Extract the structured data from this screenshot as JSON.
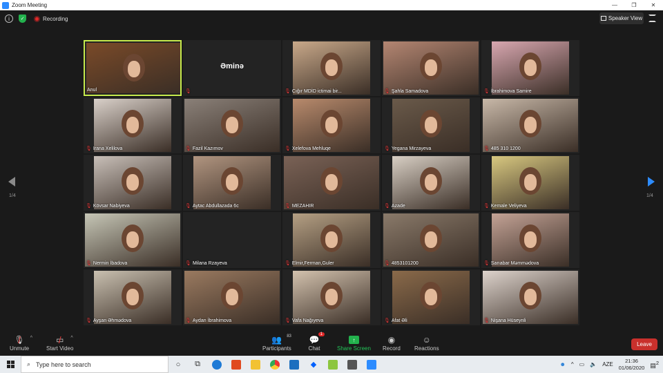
{
  "window": {
    "title": "Zoom Meeting",
    "min": "—",
    "max": "❐",
    "close": "✕"
  },
  "topbar": {
    "recording_label": "Recording",
    "speaker_view_label": "Speaker View"
  },
  "pagination": {
    "left": "1/4",
    "right": "1/4"
  },
  "participants": [
    {
      "name": "Anul",
      "active": true,
      "muted": false,
      "bg": "#7a4a28",
      "col": 0,
      "row": 0
    },
    {
      "name": "Əminə",
      "no_video": true,
      "muted": true,
      "col": 1,
      "row": 0
    },
    {
      "name": "Cığır MDİD ictimai bir...",
      "muted": true,
      "bg": "#c9a98a",
      "col": 2,
      "row": 0
    },
    {
      "name": "Şahla Samadova",
      "muted": true,
      "bg": "#b48672",
      "col": 3,
      "row": 0
    },
    {
      "name": "İbrahimova Samire",
      "muted": true,
      "bg": "#d8a7b0",
      "col": 4,
      "row": 0
    },
    {
      "name": "Irana Xelilova",
      "muted": true,
      "bg": "#d9d0c9",
      "col": 0,
      "row": 1
    },
    {
      "name": "Fazil Kazımov",
      "muted": true,
      "bg": "#8a8078",
      "col": 1,
      "row": 1
    },
    {
      "name": "Xelefova Mehluqe",
      "muted": true,
      "bg": "#b88a6c",
      "col": 2,
      "row": 1
    },
    {
      "name": "Yegana Mirzayeva",
      "muted": true,
      "bg": "#6a5a4a",
      "col": 3,
      "row": 1
    },
    {
      "name": "485 310 1200",
      "muted": true,
      "bg": "#c8b8a8",
      "col": 4,
      "row": 1
    },
    {
      "name": "Kövsar Nabiyeva",
      "muted": true,
      "bg": "#c8bfb8",
      "col": 0,
      "row": 2
    },
    {
      "name": "Aytac Abdullazada 6c",
      "muted": true,
      "bg": "#b19580",
      "col": 1,
      "row": 2
    },
    {
      "name": "MEZAHIR",
      "muted": true,
      "bg": "#7a6256",
      "col": 2,
      "row": 2
    },
    {
      "name": "Azade",
      "muted": true,
      "bg": "#d8cfc4",
      "col": 3,
      "row": 2
    },
    {
      "name": "Kemale Veliyeva",
      "muted": true,
      "bg": "#d8c880",
      "col": 4,
      "row": 2
    },
    {
      "name": "Nermin İbadova",
      "muted": true,
      "bg": "#c6c6b6",
      "col": 0,
      "row": 3
    },
    {
      "name": "Milana Rzayeva",
      "no_video": true,
      "muted": true,
      "col": 1,
      "row": 3
    },
    {
      "name": "Elmir,Ferman,Guler",
      "muted": true,
      "bg": "#b5a084",
      "col": 2,
      "row": 3
    },
    {
      "name": "4853101200",
      "muted": true,
      "bg": "#8a7a6a",
      "col": 3,
      "row": 3
    },
    {
      "name": "Sarıabar Məmmədova",
      "muted": true,
      "bg": "#c4a396",
      "col": 4,
      "row": 3
    },
    {
      "name": "Ayşan Əhmədova",
      "muted": true,
      "bg": "#c9c0b0",
      "col": 0,
      "row": 4
    },
    {
      "name": "Aydan İbrahimova",
      "muted": true,
      "bg": "#9a7a60",
      "col": 1,
      "row": 4
    },
    {
      "name": "Vafa Nağıyeva",
      "muted": true,
      "bg": "#d3c2ae",
      "col": 2,
      "row": 4
    },
    {
      "name": "Afat Əli",
      "muted": true,
      "bg": "#8a6a4a",
      "col": 3,
      "row": 4
    },
    {
      "name": "Nişana Hüseynli",
      "muted": true,
      "bg": "#ddd3cc",
      "col": 4,
      "row": 4
    }
  ],
  "controls": {
    "unmute": "Unmute",
    "start_video": "Start Video",
    "participants": "Participants",
    "participants_count": "83",
    "chat": "Chat",
    "chat_badge": "1",
    "share_screen": "Share Screen",
    "record": "Record",
    "reactions": "Reactions",
    "leave": "Leave"
  },
  "taskbar": {
    "search_placeholder": "Type here to search",
    "language": "AZE",
    "time": "21:36",
    "date": "01/06/2020",
    "notifications": "2"
  },
  "colors": {
    "active_border": "#c6ea4c",
    "share_green": "#23b14d",
    "leave_red": "#c9302c",
    "arrow_blue": "#2d8cff"
  }
}
